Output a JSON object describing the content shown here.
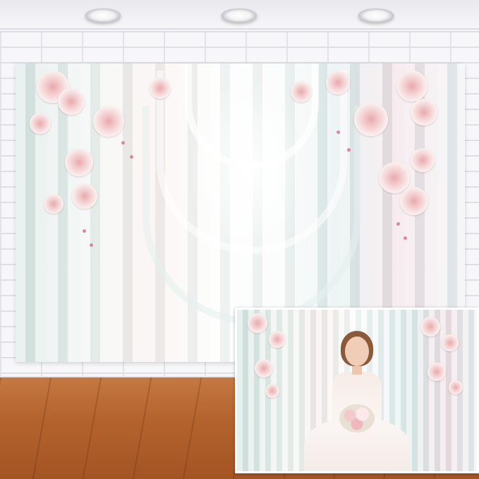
{
  "scene": {
    "description_items": [
      "wall",
      "ceiling-lights",
      "backdrop",
      "wood-floor",
      "inset-preview"
    ],
    "colors": {
      "wall": "#f4f4f6",
      "floor": "#b5642e",
      "drape_green": "#cfe0dc",
      "drape_pink": "#efd9df",
      "rose": "#e9a9ad",
      "blossom": "#d987a5"
    },
    "ceiling_light_count": 3,
    "inset": {
      "subject": "bride-with-bouquet"
    }
  }
}
